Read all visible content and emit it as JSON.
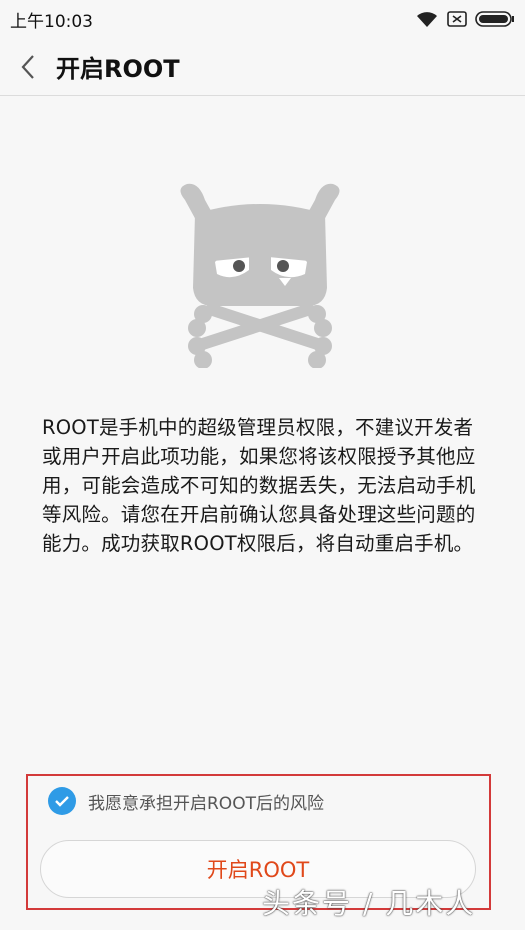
{
  "status_bar": {
    "time": "上午10:03"
  },
  "header": {
    "title": "开启ROOT"
  },
  "main": {
    "description": "ROOT是手机中的超级管理员权限，不建议开发者或用户开启此项功能，如果您将该权限授予其他应用，可能会造成不可知的数据丢失，无法启动手机等风险。请您在开启前确认您具备处理这些问题的能力。成功获取ROOT权限后，将自动重启手机。",
    "agree_label": "我愿意承担开启ROOT后的风险",
    "agree_checked": true,
    "enable_button": "开启ROOT"
  },
  "watermark": "头条号 / 几木人",
  "colors": {
    "accent_check": "#2f9be6",
    "button_text": "#e0481a",
    "highlight": "#d33a3a"
  }
}
